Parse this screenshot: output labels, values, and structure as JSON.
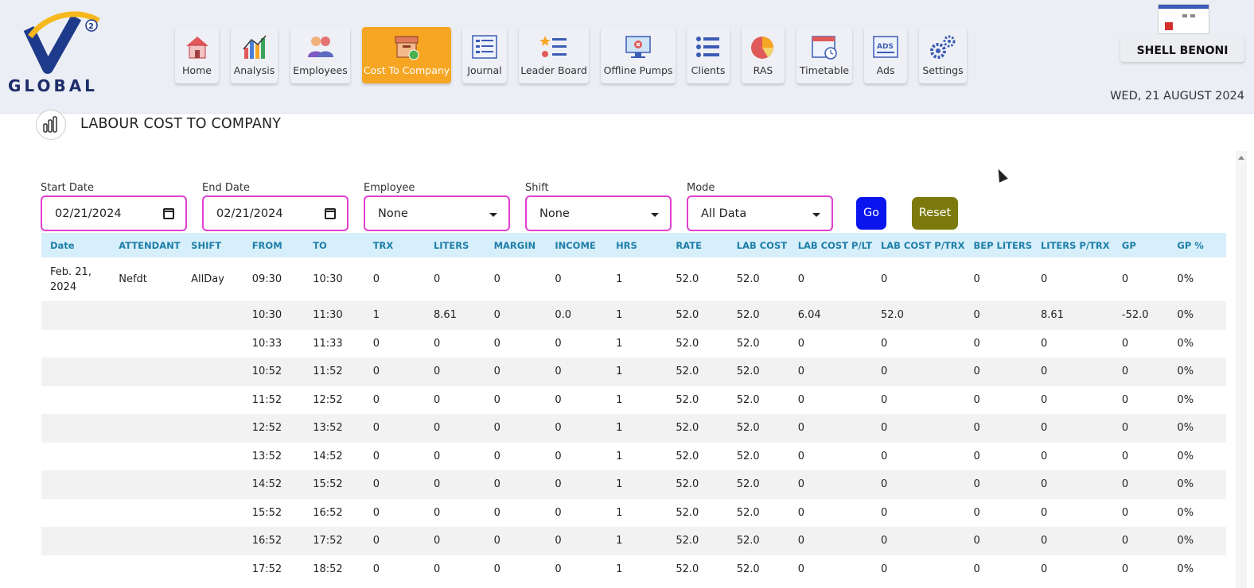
{
  "logo": {
    "text": "GLOBAL",
    "superscript": "2"
  },
  "nav": [
    {
      "label": "Home",
      "icon": "home-icon",
      "active": false
    },
    {
      "label": "Analysis",
      "icon": "analysis-icon",
      "active": false
    },
    {
      "label": "Employees",
      "icon": "employees-icon",
      "active": false
    },
    {
      "label": "Cost To Company",
      "icon": "cost-box-icon",
      "active": true
    },
    {
      "label": "Journal",
      "icon": "journal-icon",
      "active": false
    },
    {
      "label": "Leader Board",
      "icon": "leaderboard-icon",
      "active": false
    },
    {
      "label": "Offline Pumps",
      "icon": "offline-pumps-icon",
      "active": false
    },
    {
      "label": "Clients",
      "icon": "clients-icon",
      "active": false
    },
    {
      "label": "RAS",
      "icon": "ras-pie-icon",
      "active": false
    },
    {
      "label": "Timetable",
      "icon": "timetable-icon",
      "active": false
    },
    {
      "label": "Ads",
      "icon": "ads-icon",
      "active": false
    },
    {
      "label": "Settings",
      "icon": "settings-gear-icon",
      "active": false
    }
  ],
  "user": {
    "name": "SHELL BENONI"
  },
  "current_date": "WED, 21 AUGUST 2024",
  "page": {
    "title": "LABOUR COST TO COMPANY"
  },
  "filters": {
    "start_date": {
      "label": "Start Date",
      "value": "02/21/2024"
    },
    "end_date": {
      "label": "End Date",
      "value": "02/21/2024"
    },
    "employee": {
      "label": "Employee",
      "value": "None"
    },
    "shift": {
      "label": "Shift",
      "value": "None"
    },
    "mode": {
      "label": "Mode",
      "value": "All Data"
    }
  },
  "buttons": {
    "go": "Go",
    "reset": "Reset"
  },
  "colors": {
    "accent_active": "#f6a623",
    "go": "#0a14ef",
    "reset": "#7c7a0c",
    "field_border": "#e23fd0",
    "header_row": "#d7eefb",
    "header_text": "#1e7fa8"
  },
  "table": {
    "columns": [
      "Date",
      "ATTENDANT",
      "SHIFT",
      "FROM",
      "TO",
      "TRX",
      "LITERS",
      "MARGIN",
      "INCOME",
      "HRS",
      "RATE",
      "LAB COST",
      "LAB COST P/LT",
      "LAB COST P/TRX",
      "BEP LITERS",
      "LITERS P/TRX",
      "GP",
      "GP %"
    ],
    "rows": [
      [
        "Feb. 21, 2024",
        "Nefdt",
        "AllDay",
        "09:30",
        "10:30",
        "0",
        "0",
        "0",
        "0",
        "1",
        "52.0",
        "52.0",
        "0",
        "0",
        "0",
        "0",
        "0",
        "0%"
      ],
      [
        "",
        "",
        "",
        "10:30",
        "11:30",
        "1",
        "8.61",
        "0",
        "0.0",
        "1",
        "52.0",
        "52.0",
        "6.04",
        "52.0",
        "0",
        "8.61",
        "-52.0",
        "0%"
      ],
      [
        "",
        "",
        "",
        "10:33",
        "11:33",
        "0",
        "0",
        "0",
        "0",
        "1",
        "52.0",
        "52.0",
        "0",
        "0",
        "0",
        "0",
        "0",
        "0%"
      ],
      [
        "",
        "",
        "",
        "10:52",
        "11:52",
        "0",
        "0",
        "0",
        "0",
        "1",
        "52.0",
        "52.0",
        "0",
        "0",
        "0",
        "0",
        "0",
        "0%"
      ],
      [
        "",
        "",
        "",
        "11:52",
        "12:52",
        "0",
        "0",
        "0",
        "0",
        "1",
        "52.0",
        "52.0",
        "0",
        "0",
        "0",
        "0",
        "0",
        "0%"
      ],
      [
        "",
        "",
        "",
        "12:52",
        "13:52",
        "0",
        "0",
        "0",
        "0",
        "1",
        "52.0",
        "52.0",
        "0",
        "0",
        "0",
        "0",
        "0",
        "0%"
      ],
      [
        "",
        "",
        "",
        "13:52",
        "14:52",
        "0",
        "0",
        "0",
        "0",
        "1",
        "52.0",
        "52.0",
        "0",
        "0",
        "0",
        "0",
        "0",
        "0%"
      ],
      [
        "",
        "",
        "",
        "14:52",
        "15:52",
        "0",
        "0",
        "0",
        "0",
        "1",
        "52.0",
        "52.0",
        "0",
        "0",
        "0",
        "0",
        "0",
        "0%"
      ],
      [
        "",
        "",
        "",
        "15:52",
        "16:52",
        "0",
        "0",
        "0",
        "0",
        "1",
        "52.0",
        "52.0",
        "0",
        "0",
        "0",
        "0",
        "0",
        "0%"
      ],
      [
        "",
        "",
        "",
        "16:52",
        "17:52",
        "0",
        "0",
        "0",
        "0",
        "1",
        "52.0",
        "52.0",
        "0",
        "0",
        "0",
        "0",
        "0",
        "0%"
      ],
      [
        "",
        "",
        "",
        "17:52",
        "18:52",
        "0",
        "0",
        "0",
        "0",
        "1",
        "52.0",
        "52.0",
        "0",
        "0",
        "0",
        "0",
        "0",
        "0%"
      ]
    ]
  }
}
